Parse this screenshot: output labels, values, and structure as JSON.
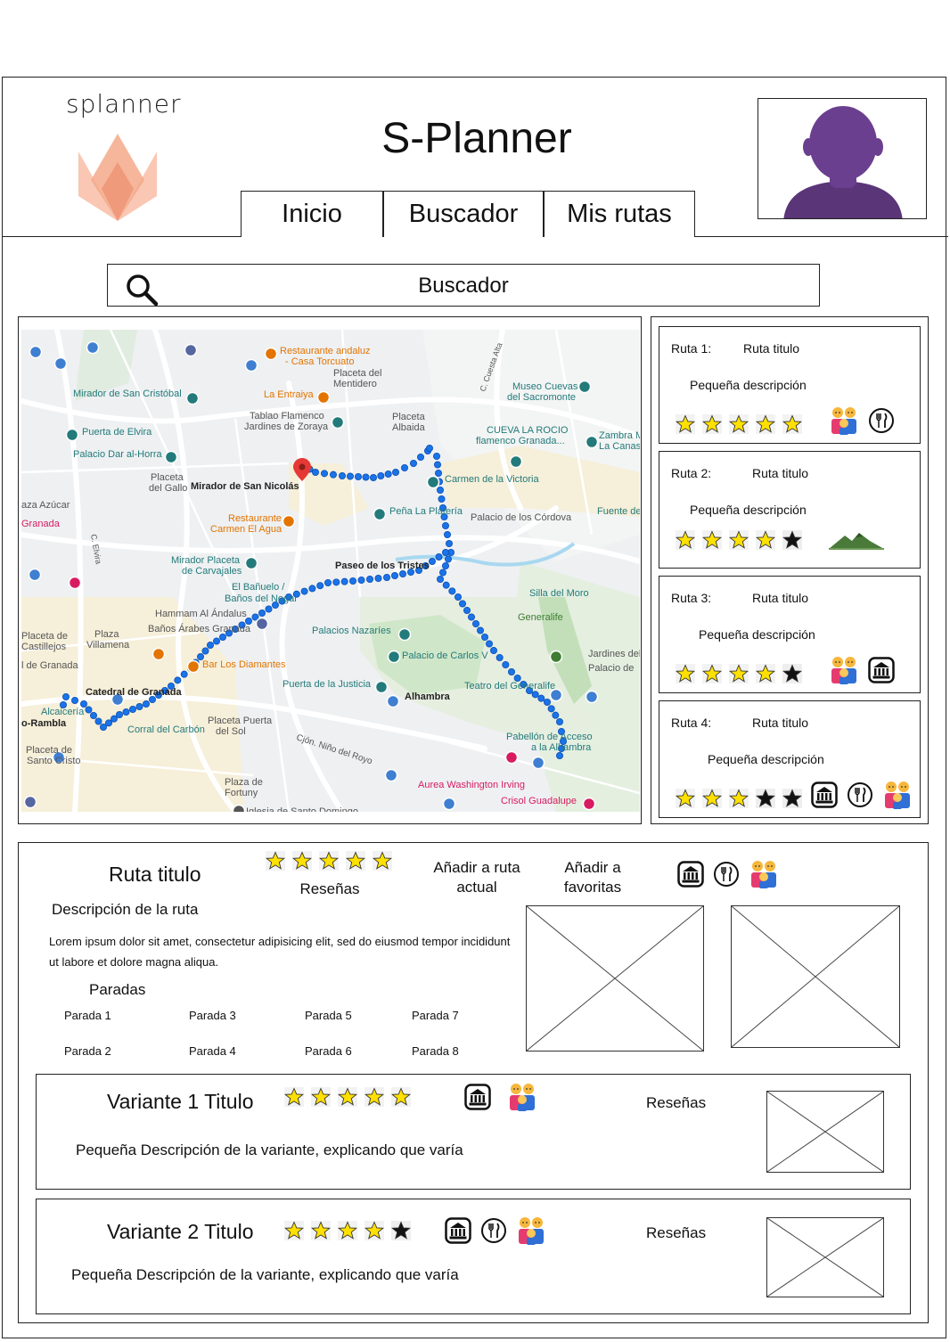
{
  "header": {
    "brand": "splanner",
    "title": "S-Planner",
    "nav": [
      "Inicio",
      "Buscador",
      "Mis rutas"
    ]
  },
  "search": {
    "label": "Buscador"
  },
  "map": {
    "labels": [
      "Restaurante andaluz",
      "- Casa Torcuato",
      "Placeta del",
      "Mentidero",
      "Mirador de San Cristóbal",
      "La Entraiya",
      "Museo Cuevas",
      "del Sacromonte",
      "Tablao Flamenco",
      "Jardines de Zoraya",
      "Placeta",
      "Albaida",
      "CUEVA LA ROCIO",
      "flamenco Granada...",
      "Zambra M",
      "La Canas",
      "Puerta de Elvira",
      "Palacio Dar al-Horra",
      "Carmen de la Victoria",
      "Placeta",
      "del Gallo",
      "Mirador de San Nicolás",
      "aza Azúcar",
      "Peña La Platería",
      "Palacio de los Córdova",
      "Fuente de",
      "Granada",
      "Restaurante",
      "Carmen El Agua",
      "Mirador Placeta",
      "de Carvajales",
      "Paseo de los Tristes",
      "El Bañuelo /",
      "Baños del Nogal",
      "Silla del Moro",
      "Hammam Al Ándalus",
      "Baños Árabes Granada",
      "Generalife",
      "Palacios Nazaríes",
      "Placeta de",
      "Castillejos",
      "Plaza",
      "Villamena",
      "Palacio de Carlos V",
      "Jardines del Gen",
      "Palacio de",
      "l de Granada",
      "Bar Los Diamantes",
      "Puerta de la Justicia",
      "Teatro del Generalife",
      "Catedral de Granada",
      "Alhambra",
      "Alcaicería",
      "o-Rambla",
      "Corral del Carbón",
      "Placeta Puerta",
      "del Sol",
      "Cjón. Niño del Royo",
      "Pabellón de Acceso",
      "a la Alhambra",
      "Placeta de",
      "Santo Cristo",
      "Plaza de",
      "Fortuny",
      "Aurea Washington Irving",
      "Crisol Guadalupe",
      "Iglesia de Santo Domingo",
      "C. Cuesta Alta",
      "C. Elvira"
    ]
  },
  "routes": [
    {
      "num": "Ruta 1:",
      "title": "Ruta titulo",
      "desc": "Pequeña descripción",
      "rating": 5,
      "icons": [
        "family-icon",
        "restaurant-icon"
      ]
    },
    {
      "num": "Ruta 2:",
      "title": "Ruta titulo",
      "desc": "Pequeña descripción",
      "rating": 4,
      "icons": [
        "mountain-icon"
      ]
    },
    {
      "num": "Ruta 3:",
      "title": "Ruta titulo",
      "desc": "Pequeña descripción",
      "rating": 4,
      "icons": [
        "family-icon",
        "museum-icon"
      ]
    },
    {
      "num": "Ruta 4:",
      "title": "Ruta titulo",
      "desc": "Pequeña descripción",
      "rating": 3,
      "icons": [
        "museum-icon",
        "restaurant-icon",
        "family-icon"
      ]
    }
  ],
  "detail": {
    "title": "Ruta titulo",
    "rating": 5,
    "reviews": "Reseñas",
    "add_current": "Añadir a ruta actual",
    "add_favorites": "Añadir a favoritas",
    "icons": [
      "museum-icon",
      "restaurant-icon",
      "family-icon"
    ],
    "subtitle": "Descripción de la ruta",
    "lorem": "Lorem ipsum dolor sit amet, consectetur adipisicing elit, sed do eiusmod tempor incididunt ut labore et dolore magna aliqua.",
    "stops_title": "Paradas",
    "stops": [
      "Parada 1",
      "Parada 2",
      "Parada 3",
      "Parada 4",
      "Parada 5",
      "Parada 6",
      "Parada 7",
      "Parada 8"
    ]
  },
  "variants": [
    {
      "title": "Variante 1 Titulo",
      "rating": 5,
      "icons": [
        "museum-icon",
        "family-icon"
      ],
      "desc": "Pequeña Descripción de la variante, explicando que varía",
      "reviews": "Reseñas"
    },
    {
      "title": "Variante 2 Titulo",
      "rating": 4,
      "icons": [
        "museum-icon",
        "restaurant-icon",
        "family-icon"
      ],
      "desc": "Pequeña Descripción de la variante, explicando que varía",
      "reviews": "Reseñas"
    }
  ],
  "colors": {
    "accent_purple": "#6b3f8f",
    "logo_orange": "#f4a98a",
    "route_blue": "#1a73e8",
    "star_yellow": "#ffe000"
  }
}
